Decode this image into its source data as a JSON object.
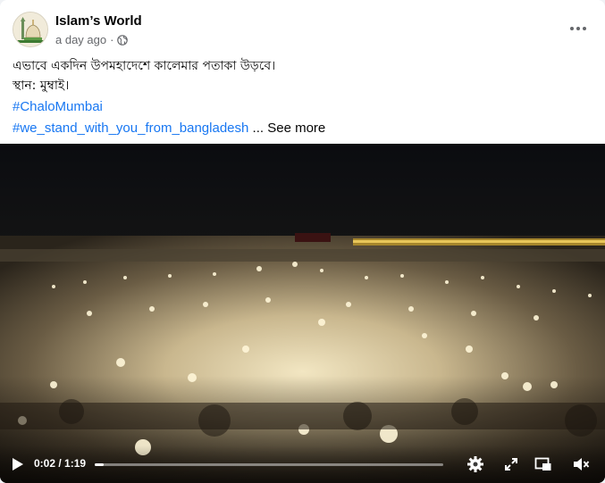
{
  "post": {
    "page_name": "Islam’s World",
    "timestamp": "a day ago",
    "separator": "·",
    "privacy_icon": "globe-icon",
    "more_icon": "more-options-icon",
    "text_line1": "এভাবে একদিন উপমহাদেশে কালেমার পতাকা উড়বে।",
    "text_line2": "স্থান: মুম্বাই।",
    "hashtags": [
      "#ChaloMumbai",
      "#we_stand_with_you_from_bangladesh"
    ],
    "ellipsis": "...",
    "see_more": "See more"
  },
  "video": {
    "current_time": "0:02",
    "time_separator": " / ",
    "duration": "1:19",
    "progress": 0.025,
    "icons": [
      "play-icon",
      "settings-gear-icon",
      "fullscreen-icon",
      "picture-in-picture-icon",
      "volume-icon"
    ]
  },
  "colors": {
    "link": "#1877f2",
    "text": "#050505",
    "secondary_text": "#65676b",
    "card": "#ffffff"
  }
}
